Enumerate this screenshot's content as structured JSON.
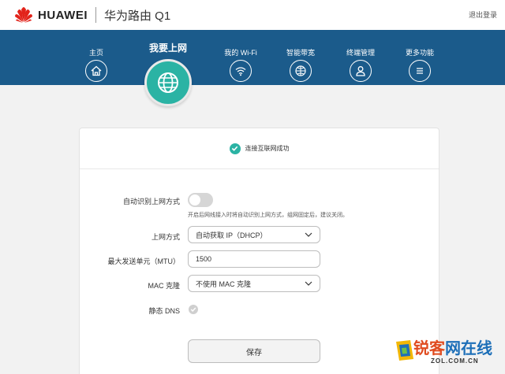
{
  "header": {
    "brand": "HUAWEI",
    "product": "华为路由 Q1",
    "logout": "退出登录"
  },
  "nav": {
    "items": [
      {
        "label": "主页",
        "icon": "home-icon"
      },
      {
        "label": "我要上网",
        "icon": "globe-icon",
        "active": true
      },
      {
        "label": "我的 Wi-Fi",
        "icon": "wifi-icon"
      },
      {
        "label": "智能带宽",
        "icon": "bandwidth-icon"
      },
      {
        "label": "终端管理",
        "icon": "user-icon"
      },
      {
        "label": "更多功能",
        "icon": "menu-icon"
      }
    ]
  },
  "status": {
    "text": "连接互联网成功",
    "color": "#2bb3a4"
  },
  "form": {
    "auto_detect": {
      "label": "自动识别上网方式",
      "enabled": false,
      "hint": "开启后网线接入时将自动识别上网方式，组网固定后，建议关闭。"
    },
    "wan_mode": {
      "label": "上网方式",
      "value": "自动获取 IP（DHCP）"
    },
    "mtu": {
      "label": "最大发送单元（MTU）",
      "value": "1500"
    },
    "mac_clone": {
      "label": "MAC 克隆",
      "value": "不使用 MAC 克隆"
    },
    "static_dns": {
      "label": "静态 DNS",
      "enabled": false
    },
    "save_label": "保存"
  },
  "watermark": {
    "title_a": "锐客",
    "title_b": "网",
    "title_c": "在线",
    "sub": "ZOL.COM.CN"
  },
  "colors": {
    "brand_red": "#e2231a",
    "nav_blue": "#1b5b8b",
    "accent": "#2bb3a4"
  }
}
